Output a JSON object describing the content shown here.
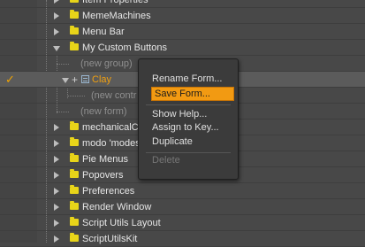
{
  "tree": {
    "items": [
      {
        "label": "Item Properties"
      },
      {
        "label": "MemeMachines"
      },
      {
        "label": "Menu Bar"
      },
      {
        "label": "My Custom Buttons"
      },
      {
        "label": "(new group)"
      },
      {
        "label": "Clay"
      },
      {
        "label": "(new contr"
      },
      {
        "label": "(new form)"
      },
      {
        "label": "mechanicalCo"
      },
      {
        "label": "modo 'modes"
      },
      {
        "label": "Pie Menus"
      },
      {
        "label": "Popovers"
      },
      {
        "label": "Preferences"
      },
      {
        "label": "Render Window"
      },
      {
        "label": "Script Utils Layout"
      },
      {
        "label": "ScriptUtilsKit"
      }
    ],
    "check_mark": "✓",
    "expand_mark": "+"
  },
  "context_menu": {
    "items": [
      {
        "label": "Rename Form..."
      },
      {
        "label": "Save Form..."
      },
      {
        "label": "Show Help..."
      },
      {
        "label": "Assign to Key..."
      },
      {
        "label": "Duplicate"
      },
      {
        "label": "Delete"
      }
    ],
    "highlighted": "Save Form...",
    "disabled": [
      "Delete"
    ]
  },
  "colors": {
    "background": "#484848",
    "highlight": "#f29a12",
    "selected_text": "#f1a010",
    "folder": "#e8d419"
  }
}
